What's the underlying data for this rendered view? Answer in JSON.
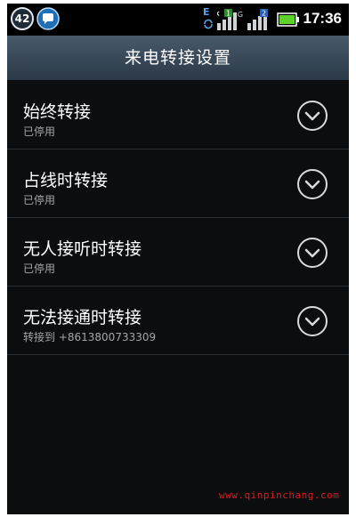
{
  "status_bar": {
    "notification_count": "42",
    "network_type": "E",
    "sim1_badge": "1",
    "sim1_net": "G",
    "sim2_badge": "2",
    "time": "17:36"
  },
  "header": {
    "title": "来电转接设置"
  },
  "items": [
    {
      "label": "始终转接",
      "status": "已停用"
    },
    {
      "label": "占线时转接",
      "status": "已停用"
    },
    {
      "label": "无人接听时转接",
      "status": "已停用"
    },
    {
      "label": "无法接通时转接",
      "status": "转接到 +8613800733309"
    }
  ],
  "watermark": "www.qinpinchang.com",
  "colors": {
    "background": "#0c0d0f",
    "titlebar": "#3a4a5a",
    "watermark": "#e21b1b"
  }
}
